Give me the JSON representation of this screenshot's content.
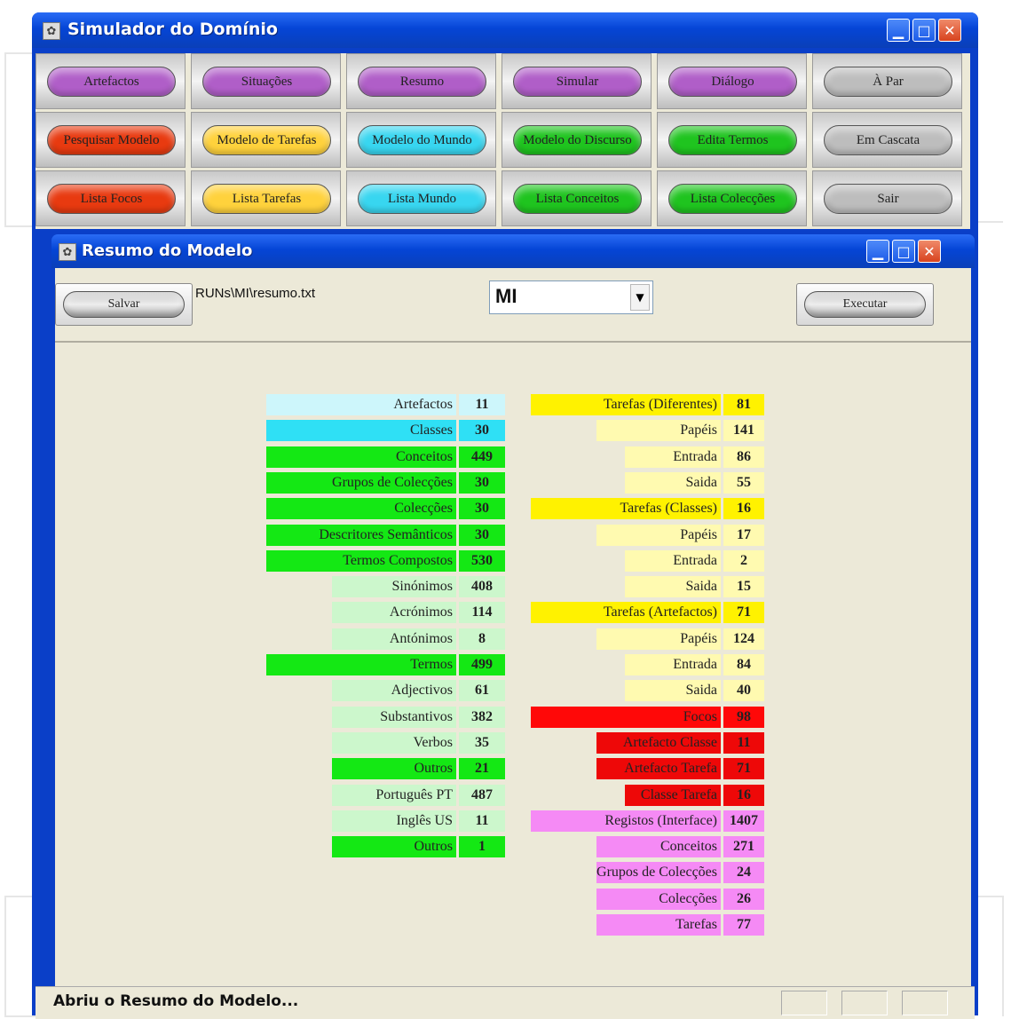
{
  "main_window": {
    "title": "Simulador do Domínio",
    "minimize": "▁",
    "maximize": "□",
    "close": "✕"
  },
  "toolbar": {
    "buttons": [
      {
        "label": "Artefactos",
        "color": "#b05ec8"
      },
      {
        "label": "Situações",
        "color": "#b05ec8"
      },
      {
        "label": "Resumo",
        "color": "#b05ec8"
      },
      {
        "label": "Simular",
        "color": "#b05ec8"
      },
      {
        "label": "Diálogo",
        "color": "#b05ec8"
      },
      {
        "label": "À Par",
        "color": "#bdbdbd"
      },
      {
        "label": "Pesquisar Modelo",
        "color": "#e83a10"
      },
      {
        "label": "Modelo de Tarefas",
        "color": "#ffd23c"
      },
      {
        "label": "Modelo do Mundo",
        "color": "#38d6f0"
      },
      {
        "label": "Modelo do Discurso",
        "color": "#1fc41f"
      },
      {
        "label": "Edita Termos",
        "color": "#1fc41f"
      },
      {
        "label": "Em Cascata",
        "color": "#bdbdbd"
      },
      {
        "label": "Lista Focos",
        "color": "#e83a10"
      },
      {
        "label": "Lista Tarefas",
        "color": "#ffd23c"
      },
      {
        "label": "Lista Mundo",
        "color": "#38d6f0"
      },
      {
        "label": "Lista Conceitos",
        "color": "#1fc41f"
      },
      {
        "label": "Lista Colecções",
        "color": "#1fc41f"
      },
      {
        "label": "Sair",
        "color": "#bdbdbd"
      }
    ]
  },
  "summary_window": {
    "title": "Resumo do Modelo",
    "save_button": "Salvar",
    "file_path": "RUNs\\MI\\resumo.txt",
    "model_select": "MI",
    "execute_button": "Executar",
    "dropdown_arrow": "▼"
  },
  "left_table": [
    {
      "label": "Artefactos",
      "value": "11",
      "color": "#cdf6fb",
      "indent": 0
    },
    {
      "label": "Classes",
      "value": "30",
      "color": "#2fe0f5",
      "indent": 0
    },
    {
      "label": "Conceitos",
      "value": "449",
      "color": "#14e814",
      "indent": 0
    },
    {
      "label": "Grupos de Colecções",
      "value": "30",
      "color": "#14e814",
      "indent": 0
    },
    {
      "label": "Colecções",
      "value": "30",
      "color": "#14e814",
      "indent": 0
    },
    {
      "label": "Descritores Semânticos",
      "value": "30",
      "color": "#14e814",
      "indent": 0
    },
    {
      "label": "Termos Compostos",
      "value": "530",
      "color": "#14e814",
      "indent": 0
    },
    {
      "label": "Sinónimos",
      "value": "408",
      "color": "#ccf7cc",
      "indent": 1
    },
    {
      "label": "Acrónimos",
      "value": "114",
      "color": "#ccf7cc",
      "indent": 1
    },
    {
      "label": "Antónimos",
      "value": "8",
      "color": "#ccf7cc",
      "indent": 1
    },
    {
      "label": "Termos",
      "value": "499",
      "color": "#14e814",
      "indent": 0
    },
    {
      "label": "Adjectivos",
      "value": "61",
      "color": "#ccf7cc",
      "indent": 1
    },
    {
      "label": "Substantivos",
      "value": "382",
      "color": "#ccf7cc",
      "indent": 1
    },
    {
      "label": "Verbos",
      "value": "35",
      "color": "#ccf7cc",
      "indent": 1
    },
    {
      "label": "Outros",
      "value": "21",
      "color": "#14e814",
      "indent": 1
    },
    {
      "label": "Português PT",
      "value": "487",
      "color": "#ccf7cc",
      "indent": 1
    },
    {
      "label": "Inglês US",
      "value": "11",
      "color": "#ccf7cc",
      "indent": 1
    },
    {
      "label": "Outros",
      "value": "1",
      "color": "#14e814",
      "indent": 1
    }
  ],
  "right_table": [
    {
      "label": "Tarefas (Diferentes)",
      "value": "81",
      "color": "#fff200",
      "indent": 0
    },
    {
      "label": "Papéis",
      "value": "141",
      "color": "#fffab0",
      "indent": 1
    },
    {
      "label": "Entrada",
      "value": "86",
      "color": "#fffab0",
      "indent": 2
    },
    {
      "label": "Saida",
      "value": "55",
      "color": "#fffab0",
      "indent": 2
    },
    {
      "label": "Tarefas (Classes)",
      "value": "16",
      "color": "#fff200",
      "indent": 0
    },
    {
      "label": "Papéis",
      "value": "17",
      "color": "#fffab0",
      "indent": 1
    },
    {
      "label": "Entrada",
      "value": "2",
      "color": "#fffab0",
      "indent": 2
    },
    {
      "label": "Saida",
      "value": "15",
      "color": "#fffab0",
      "indent": 2
    },
    {
      "label": "Tarefas (Artefactos)",
      "value": "71",
      "color": "#fff200",
      "indent": 0
    },
    {
      "label": "Papéis",
      "value": "124",
      "color": "#fffab0",
      "indent": 1
    },
    {
      "label": "Entrada",
      "value": "84",
      "color": "#fffab0",
      "indent": 2
    },
    {
      "label": "Saida",
      "value": "40",
      "color": "#fffab0",
      "indent": 2
    },
    {
      "label": "Focos",
      "value": "98",
      "color": "#ff0808",
      "indent": 0
    },
    {
      "label": "Artefacto Classe",
      "value": "11",
      "color": "#ee0808",
      "indent": 1
    },
    {
      "label": "Artefacto Tarefa",
      "value": "71",
      "color": "#ee0808",
      "indent": 1
    },
    {
      "label": "Classe Tarefa",
      "value": "16",
      "color": "#ee0808",
      "indent": 2
    },
    {
      "label": "Registos (Interface)",
      "value": "1407",
      "color": "#f58af5",
      "indent": 0
    },
    {
      "label": "Conceitos",
      "value": "271",
      "color": "#f58af5",
      "indent": 1
    },
    {
      "label": "Grupos de Colecções",
      "value": "24",
      "color": "#f58af5",
      "indent": 1
    },
    {
      "label": "Colecções",
      "value": "26",
      "color": "#f58af5",
      "indent": 1
    },
    {
      "label": "Tarefas",
      "value": "77",
      "color": "#f58af5",
      "indent": 1
    }
  ],
  "status_bar": {
    "text": "Abriu o Resumo do Modelo..."
  }
}
